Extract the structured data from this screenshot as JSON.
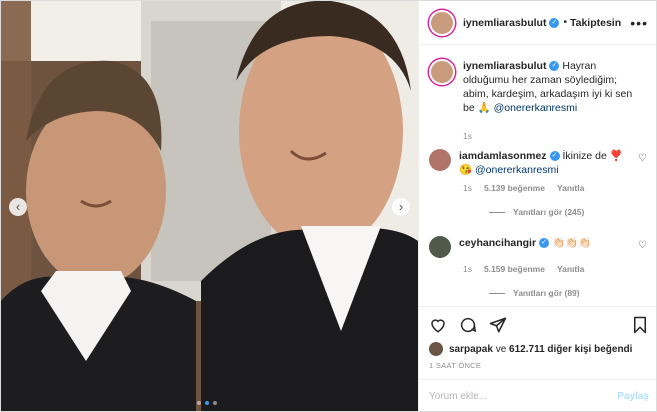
{
  "header": {
    "username": "iynemliarasbulut",
    "separator": "•",
    "follow_label": "Takiptesin",
    "more_icon": "more-icon"
  },
  "caption": {
    "username": "iynemliarasbulut",
    "text": "Hayran olduğumu her zaman söylediğim; abim, kardeşim, arkadaşım iyi ki sen be 🙏",
    "mention": "@onererkanresmi",
    "age": "1s"
  },
  "comments": [
    {
      "username": "iamdamlasonmez",
      "text": "İkinize de ❣️😘",
      "mention": "@onererkanresmi",
      "age": "1s",
      "likes": "5.139 beğenme",
      "reply_label": "Yanıtla",
      "view_replies": "Yanıtları gör (245)"
    },
    {
      "username": "ceyhancihangir",
      "text": "👏🏻👏🏻👏🏻",
      "mention": "",
      "age": "1s",
      "likes": "5.159 beğenme",
      "reply_label": "Yanıtla",
      "view_replies": "Yanıtları gör (89)"
    }
  ],
  "likes": {
    "first_user": "sarpapak",
    "joiner": " ve ",
    "count_text": "612.711 diğer kişi",
    "suffix": " beğendi"
  },
  "timestamp": "1 SAAT ÖNCE",
  "comment_input": {
    "placeholder": "Yorum ekle...",
    "post_label": "Paylaş"
  },
  "carousel": {
    "prev_icon": "chevron-left-icon",
    "next_icon": "chevron-right-icon",
    "dots": 3,
    "active_dot": 2
  },
  "colors": {
    "verified": "#3897f0",
    "link": "#00376b",
    "muted": "#8e8e8e",
    "post_disabled": "#b2dffc"
  }
}
